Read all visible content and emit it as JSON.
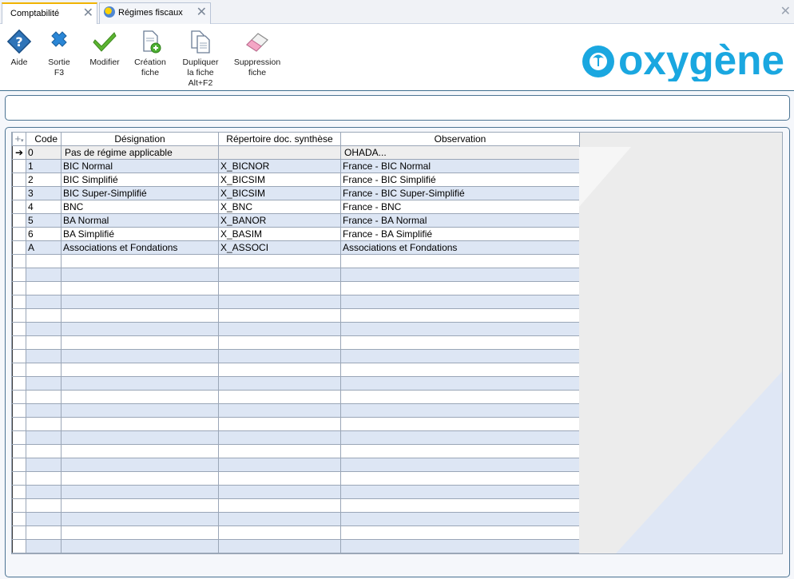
{
  "tabs": [
    {
      "label": "Comptabilité",
      "active": true
    },
    {
      "label": "Régimes fiscaux",
      "active": false
    }
  ],
  "toolbar": {
    "buttons": [
      {
        "label": "Aide",
        "icon": "help-icon"
      },
      {
        "label": "Sortie F3",
        "icon": "exit-icon"
      },
      {
        "label": "Modifier",
        "icon": "check-icon"
      },
      {
        "label": "Création fiche",
        "icon": "new-document-icon"
      },
      {
        "label": "Dupliquer la fiche Alt+F2",
        "icon": "duplicate-icon"
      },
      {
        "label": "Suppression fiche",
        "icon": "eraser-icon"
      }
    ]
  },
  "logo": {
    "text": "oxygène",
    "color": "#1aa7e0"
  },
  "grid": {
    "columns": [
      "Code",
      "Désignation",
      "Répertoire doc. synthèse",
      "Observation"
    ],
    "rows": [
      {
        "code": "0",
        "designation": "Pas de régime applicable",
        "repertoire": "",
        "observation": "OHADA..."
      },
      {
        "code": "1",
        "designation": "BIC Normal",
        "repertoire": "X_BICNOR",
        "observation": "France - BIC Normal"
      },
      {
        "code": "2",
        "designation": "BIC Simplifié",
        "repertoire": "X_BICSIM",
        "observation": "France - BIC Simplifié"
      },
      {
        "code": "3",
        "designation": "BIC Super-Simplifié",
        "repertoire": "X_BICSIM",
        "observation": "France - BIC Super-Simplifié"
      },
      {
        "code": "4",
        "designation": "BNC",
        "repertoire": "X_BNC",
        "observation": "France - BNC"
      },
      {
        "code": "5",
        "designation": "BA Normal",
        "repertoire": "X_BANOR",
        "observation": "France - BA Normal"
      },
      {
        "code": "6",
        "designation": "BA Simplifié",
        "repertoire": "X_BASIM",
        "observation": "France - BA Simplifié"
      },
      {
        "code": "A",
        "designation": "Associations et Fondations",
        "repertoire": "X_ASSOCI",
        "observation": "Associations et Fondations"
      }
    ],
    "selected_row": 0
  },
  "colors": {
    "accent": "#f0b400",
    "row_alt": "#dde6f4",
    "border": "#4c7493"
  }
}
